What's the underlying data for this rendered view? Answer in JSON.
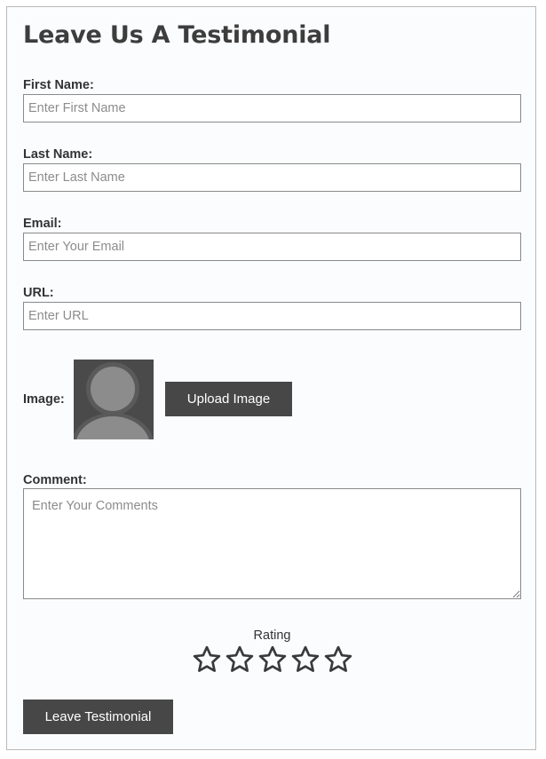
{
  "form": {
    "title": "Leave Us A Testimonial",
    "first_name": {
      "label": "First Name:",
      "placeholder": "Enter First Name",
      "value": ""
    },
    "last_name": {
      "label": "Last Name:",
      "placeholder": "Enter Last Name",
      "value": ""
    },
    "email": {
      "label": "Email:",
      "placeholder": "Enter Your Email",
      "value": ""
    },
    "url": {
      "label": "URL:",
      "placeholder": "Enter URL",
      "value": ""
    },
    "image": {
      "label": "Image:",
      "upload_label": "Upload Image",
      "avatar_icon": "default-user-avatar"
    },
    "comment": {
      "label": "Comment:",
      "placeholder": "Enter Your Comments",
      "value": ""
    },
    "rating": {
      "label": "Rating",
      "max": 5,
      "value": 0,
      "icon": "star-outline-icon"
    },
    "submit_label": "Leave Testimonial"
  },
  "colors": {
    "button_bg": "#474747",
    "button_text": "#ffffff",
    "card_bg": "#fbfcfe",
    "star_stroke": "#3a3a3a"
  }
}
